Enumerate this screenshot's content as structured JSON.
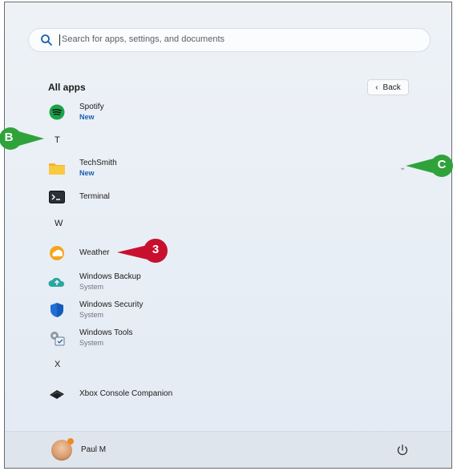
{
  "search": {
    "placeholder": "Search for apps, settings, and documents"
  },
  "heading": "All apps",
  "back_label": "Back",
  "apps": [
    {
      "name": "Spotify",
      "sub": "New"
    },
    {
      "name": "TechSmith",
      "sub": "New"
    },
    {
      "name": "Terminal",
      "sub": ""
    },
    {
      "name": "Weather",
      "sub": ""
    },
    {
      "name": "Windows Backup",
      "sub": "System"
    },
    {
      "name": "Windows Security",
      "sub": "System"
    },
    {
      "name": "Windows Tools",
      "sub": "System"
    },
    {
      "name": "Xbox Console Companion",
      "sub": ""
    }
  ],
  "letters": [
    "T",
    "W",
    "X"
  ],
  "user": {
    "name": "Paul M"
  },
  "callouts": {
    "b": "B",
    "c": "C",
    "step": "3"
  },
  "colors": {
    "callout_green": "#2fa33a",
    "callout_red": "#c8102e",
    "accent": "#1a5fb4"
  },
  "icons": [
    "search-icon",
    "spotify-icon",
    "folder-icon",
    "terminal-icon",
    "weather-icon",
    "cloud-backup-icon",
    "shield-icon",
    "tools-icon",
    "xbox-icon",
    "power-icon",
    "chevron-down-icon",
    "chevron-left-icon"
  ]
}
